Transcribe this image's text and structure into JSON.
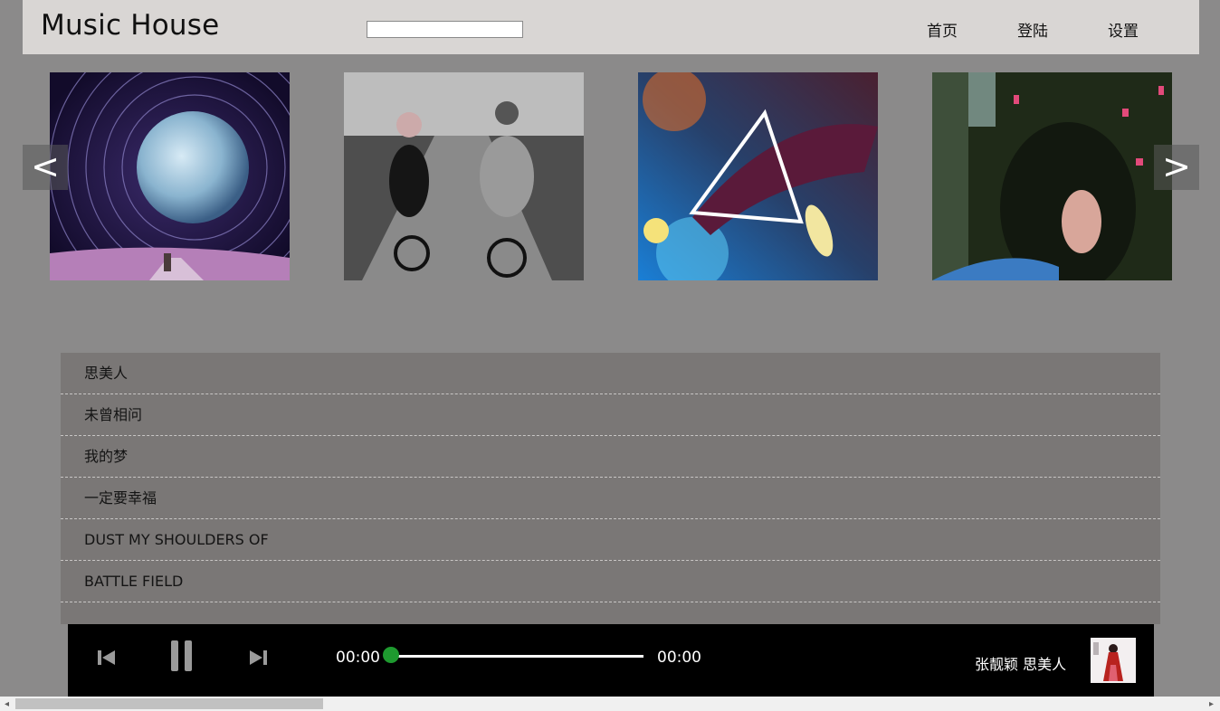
{
  "header": {
    "logo": "Music House",
    "search": {
      "value": "",
      "placeholder": ""
    },
    "nav": [
      "首页",
      "登陆",
      "设置"
    ]
  },
  "carousel": {
    "prev": "<",
    "next": ">"
  },
  "songs": [
    "思美人",
    "未曾相问",
    "我的梦",
    "一定要幸福",
    "DUST MY SHOULDERS OF",
    "BATTLE FIELD"
  ],
  "player": {
    "current_time": "00:00",
    "total_time": "00:00",
    "progress": 0,
    "now_playing": "张靓颖 思美人"
  },
  "colors": {
    "page_bg": "#8b8a8a",
    "header_bg": "#d9d6d4",
    "list_bg": "#7a7776",
    "player_bg": "#000000",
    "progress_knob": "#1e9a2f"
  }
}
